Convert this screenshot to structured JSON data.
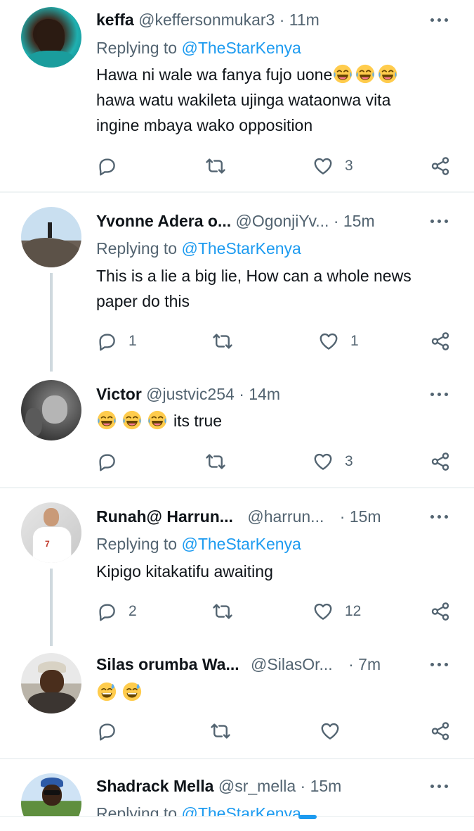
{
  "tweets": [
    {
      "name": "keffa",
      "handle": "@keffersonmukar3",
      "dot": "·",
      "time": "11m",
      "replying_prefix": "Replying to ",
      "replying_to": "@TheStarKenya",
      "text_lines": [
        "Hawa ni wale wa fanya fujo uone😂😂😂",
        "hawa watu wakileta ujinga wataonwa vita",
        "ingine mbaya wako opposition"
      ],
      "reply_count": "",
      "retweet_count": "",
      "like_count": "3"
    },
    {
      "name": "Yvonne Adera o...",
      "handle": "@OgonjiYv...",
      "dot": "·",
      "time": "15m",
      "replying_prefix": "Replying to ",
      "replying_to": "@TheStarKenya",
      "text_lines": [
        "This is a lie a big lie, How can a whole news",
        "paper do this"
      ],
      "reply_count": "1",
      "retweet_count": "",
      "like_count": "1"
    },
    {
      "name": "Victor",
      "handle": "@justvic254",
      "dot": "·",
      "time": "14m",
      "text_lines": [
        "😂😂😂 its true"
      ],
      "reply_count": "",
      "retweet_count": "",
      "like_count": "3"
    },
    {
      "name": "Runah@ Harrun...",
      "handle": "@harrun...",
      "dot": "·",
      "time": "15m",
      "replying_prefix": "Replying to ",
      "replying_to": "@TheStarKenya",
      "text_lines": [
        "Kipigo kitakatifu awaiting"
      ],
      "reply_count": "2",
      "retweet_count": "",
      "like_count": "12"
    },
    {
      "name": "Silas orumba Wa...",
      "handle": "@SilasOr...",
      "dot": "·",
      "time": "7m",
      "text_lines": [
        "😅😅"
      ],
      "reply_count": "",
      "retweet_count": "",
      "like_count": ""
    },
    {
      "name": "Shadrack Mella",
      "handle": "@sr_mella",
      "dot": "·",
      "time": "15m",
      "replying_prefix": "Replying to ",
      "replying_to": "@TheStarKenya"
    }
  ],
  "colors": {
    "accent": "#1d9bf0",
    "secondary_text": "#536471",
    "divider": "#eff3f4",
    "thread_line": "#cfd9de"
  },
  "icons": {
    "reply": "reply-icon",
    "retweet": "retweet-icon",
    "like": "heart-icon",
    "share": "share-icon",
    "more": "more-icon"
  }
}
